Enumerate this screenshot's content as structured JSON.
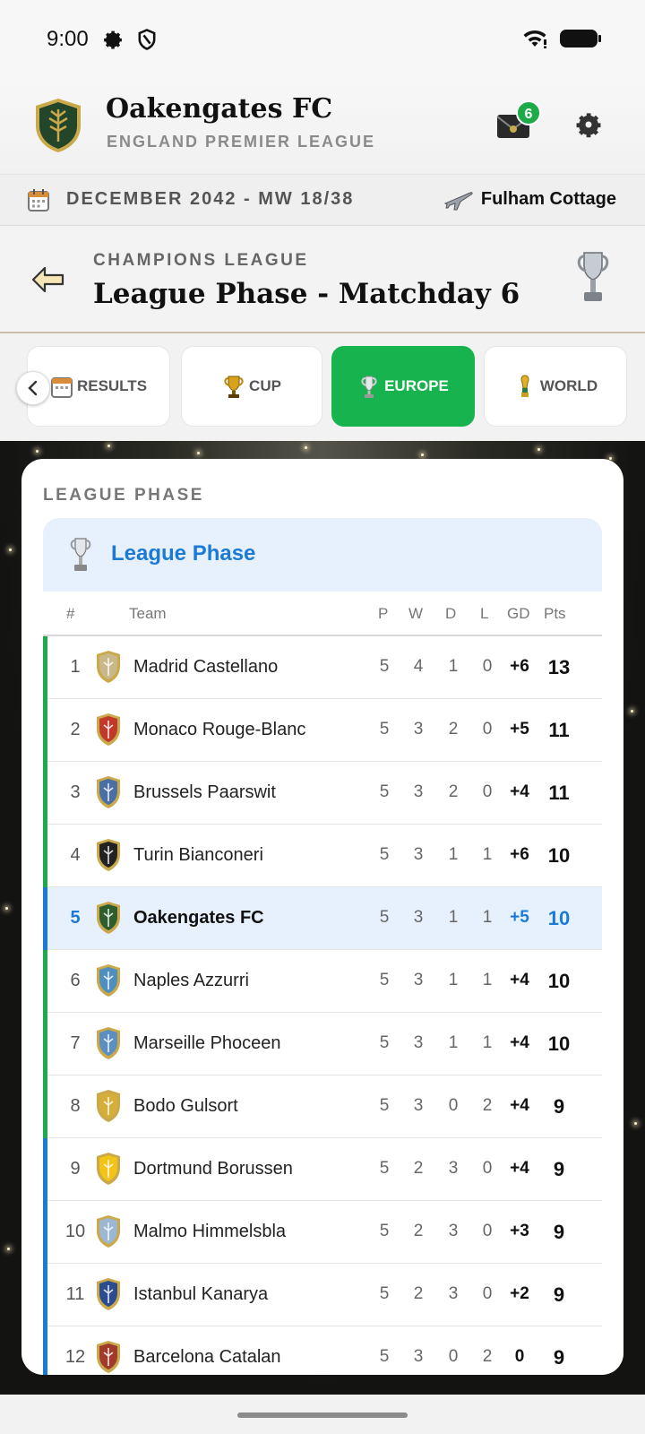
{
  "status_bar": {
    "time": "9:00"
  },
  "header": {
    "club_name": "Oakengates FC",
    "league": "ENGLAND PREMIER LEAGUE",
    "mail_count": "6"
  },
  "date_bar": {
    "date": "DECEMBER 2042 - MW 18/38",
    "venue": "Fulham Cottage"
  },
  "competition": {
    "kicker": "CHAMPIONS LEAGUE",
    "title": "League Phase - Matchday 6"
  },
  "tabs": [
    {
      "label": "RESULTS",
      "icon": "calendar-icon"
    },
    {
      "label": "CUP",
      "icon": "cup-trophy-icon"
    },
    {
      "label": "EUROPE",
      "icon": "europe-trophy-icon",
      "active": true
    },
    {
      "label": "WORLD",
      "icon": "world-trophy-icon"
    }
  ],
  "table": {
    "section_title": "LEAGUE PHASE",
    "group_name": "League Phase",
    "headers": {
      "pos": "#",
      "team": "Team",
      "p": "P",
      "w": "W",
      "d": "D",
      "l": "L",
      "gd": "GD",
      "pts": "Pts"
    },
    "rows": [
      {
        "pos": "1",
        "team": "Madrid Castellano",
        "p": "5",
        "w": "4",
        "d": "1",
        "l": "0",
        "gd": "+6",
        "pts": "13",
        "zone": "green"
      },
      {
        "pos": "2",
        "team": "Monaco Rouge-Blanc",
        "p": "5",
        "w": "3",
        "d": "2",
        "l": "0",
        "gd": "+5",
        "pts": "11",
        "zone": "green"
      },
      {
        "pos": "3",
        "team": "Brussels Paarswit",
        "p": "5",
        "w": "3",
        "d": "2",
        "l": "0",
        "gd": "+4",
        "pts": "11",
        "zone": "green"
      },
      {
        "pos": "4",
        "team": "Turin Bianconeri",
        "p": "5",
        "w": "3",
        "d": "1",
        "l": "1",
        "gd": "+6",
        "pts": "10",
        "zone": "green"
      },
      {
        "pos": "5",
        "team": "Oakengates FC",
        "p": "5",
        "w": "3",
        "d": "1",
        "l": "1",
        "gd": "+5",
        "pts": "10",
        "zone": "blue",
        "mine": true
      },
      {
        "pos": "6",
        "team": "Naples Azzurri",
        "p": "5",
        "w": "3",
        "d": "1",
        "l": "1",
        "gd": "+4",
        "pts": "10",
        "zone": "green"
      },
      {
        "pos": "7",
        "team": "Marseille Phoceen",
        "p": "5",
        "w": "3",
        "d": "1",
        "l": "1",
        "gd": "+4",
        "pts": "10",
        "zone": "green"
      },
      {
        "pos": "8",
        "team": "Bodo Gulsort",
        "p": "5",
        "w": "3",
        "d": "0",
        "l": "2",
        "gd": "+4",
        "pts": "9",
        "zone": "green"
      },
      {
        "pos": "9",
        "team": "Dortmund Borussen",
        "p": "5",
        "w": "2",
        "d": "3",
        "l": "0",
        "gd": "+4",
        "pts": "9",
        "zone": "blue"
      },
      {
        "pos": "10",
        "team": "Malmo Himmelsbla",
        "p": "5",
        "w": "2",
        "d": "3",
        "l": "0",
        "gd": "+3",
        "pts": "9",
        "zone": "blue"
      },
      {
        "pos": "11",
        "team": "Istanbul Kanarya",
        "p": "5",
        "w": "2",
        "d": "3",
        "l": "0",
        "gd": "+2",
        "pts": "9",
        "zone": "blue"
      },
      {
        "pos": "12",
        "team": "Barcelona Catalan",
        "p": "5",
        "w": "3",
        "d": "0",
        "l": "2",
        "gd": "0",
        "pts": "9",
        "zone": "blue"
      }
    ]
  },
  "colors": {
    "accent_green": "#17b34e",
    "accent_blue": "#1b7ad6",
    "zone_green": "#1faa4a",
    "zone_blue": "#1b7ad6",
    "badge_palette": [
      "#c9b98a",
      "#c0392b",
      "#4a6fa5",
      "#222222",
      "#2e5d2e",
      "#4f8fbf",
      "#5b8fc2",
      "#d4b03a",
      "#f2c318",
      "#9bb7d4",
      "#2b4d8f",
      "#a03a2a"
    ]
  }
}
